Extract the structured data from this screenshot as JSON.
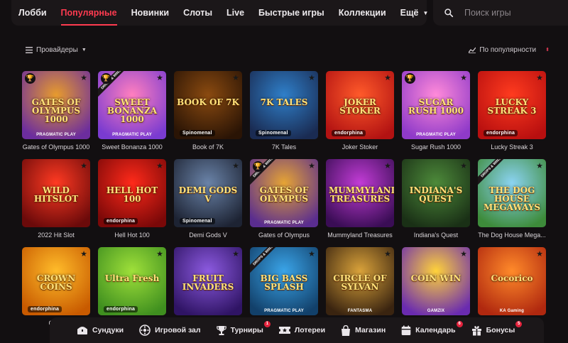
{
  "nav": {
    "items": [
      "Лобби",
      "Популярные",
      "Новинки",
      "Слоты",
      "Live",
      "Быстрые игры",
      "Коллекции"
    ],
    "active_index": 1,
    "more_label": "Ещё"
  },
  "search": {
    "placeholder": "Поиск игры"
  },
  "filters": {
    "providers_label": "Провайдеры",
    "sort_label": "По популярности"
  },
  "games": [
    {
      "label": "Gates of Olympus 1000",
      "art": "GATES OF OLYMPUS 1000",
      "provider": "PRAGMATIC PLAY",
      "trophy": true,
      "drops": false,
      "bg": [
        "#e79b2d",
        "#6c2d9e"
      ]
    },
    {
      "label": "Sweet Bonanza 1000",
      "art": "SWEET BONANZA 1000",
      "provider": "PRAGMATIC PLAY",
      "trophy": true,
      "drops": true,
      "bg": [
        "#ff7fbf",
        "#7a3bd0"
      ]
    },
    {
      "label": "Book of 7K",
      "art": "BOOK OF 7K",
      "provider": "Spinomenal",
      "trophy": false,
      "drops": false,
      "bg": [
        "#8a4a10",
        "#2a1405"
      ]
    },
    {
      "label": "7K Tales",
      "art": "7K TALES",
      "provider": "Spinomenal",
      "trophy": false,
      "drops": false,
      "bg": [
        "#2f7fc9",
        "#1a2b52"
      ]
    },
    {
      "label": "Joker Stoker",
      "art": "JOKER STOKER",
      "provider": "endorphina",
      "trophy": false,
      "drops": false,
      "bg": [
        "#ff5a2a",
        "#b21212"
      ]
    },
    {
      "label": "Sugar Rush 1000",
      "art": "SUGAR RUSH 1000",
      "provider": "PRAGMATIC PLAY",
      "trophy": true,
      "drops": false,
      "bg": [
        "#ff8ad9",
        "#8f3ac9"
      ]
    },
    {
      "label": "Lucky Streak 3",
      "art": "LUCKY STREAK 3",
      "provider": "endorphina",
      "trophy": false,
      "drops": false,
      "bg": [
        "#ff3b1f",
        "#b80f0f"
      ]
    },
    {
      "label": "2022 Hit Slot",
      "art": "WILD HITSLOT",
      "provider": "",
      "trophy": false,
      "drops": false,
      "bg": [
        "#ff3a22",
        "#6b0a0a"
      ]
    },
    {
      "label": "Hell Hot 100",
      "art": "HELL HOT 100",
      "provider": "endorphina",
      "trophy": false,
      "drops": false,
      "bg": [
        "#ff2a1a",
        "#7a0808"
      ]
    },
    {
      "label": "Demi Gods V",
      "art": "DEMI GODS V",
      "provider": "Spinomenal",
      "trophy": false,
      "drops": false,
      "bg": [
        "#6a83a8",
        "#1d2333"
      ]
    },
    {
      "label": "Gates of Olympus",
      "art": "GATES OF OLYMPUS",
      "provider": "PRAGMATIC PLAY",
      "trophy": true,
      "drops": true,
      "bg": [
        "#e6a434",
        "#5a2d8f"
      ]
    },
    {
      "label": "Mummyland Treasures",
      "art": "MUMMYLAND TREASURES",
      "provider": "",
      "trophy": false,
      "drops": false,
      "bg": [
        "#c23cd6",
        "#3a0d55"
      ]
    },
    {
      "label": "Indiana's Quest",
      "art": "INDIANA'S QUEST",
      "provider": "",
      "trophy": false,
      "drops": false,
      "bg": [
        "#4d8a3a",
        "#1a3016"
      ]
    },
    {
      "label": "The Dog House Mega...",
      "art": "THE DOG HOUSE MEGAWAYS",
      "provider": "",
      "trophy": false,
      "drops": true,
      "bg": [
        "#8bd3f2",
        "#3d8b3a"
      ]
    },
    {
      "label": "Crow",
      "art": "CROWN COINS",
      "provider": "endorphina",
      "trophy": false,
      "drops": false,
      "bg": [
        "#ffbc2a",
        "#c85a00"
      ]
    },
    {
      "label": "",
      "art": "Ultra Fresh",
      "provider": "endorphina",
      "trophy": false,
      "drops": false,
      "bg": [
        "#9fe03a",
        "#3f8f1f"
      ]
    },
    {
      "label": "",
      "art": "FRUIT INVADERS",
      "provider": "",
      "trophy": false,
      "drops": false,
      "bg": [
        "#8c5ae0",
        "#2f1464"
      ]
    },
    {
      "label": "",
      "art": "BIG BASS SPLASH",
      "provider": "PRAGMATIC PLAY",
      "trophy": false,
      "drops": true,
      "bg": [
        "#3aa4e8",
        "#12406a"
      ]
    },
    {
      "label": "",
      "art": "CIRCLE OF SYLVAN",
      "provider": "FANTASMA",
      "trophy": false,
      "drops": false,
      "bg": [
        "#d9a23a",
        "#3a2410"
      ]
    },
    {
      "label": "",
      "art": "COIN WIN",
      "provider": "GAMZIX",
      "trophy": false,
      "drops": false,
      "bg": [
        "#ffd23a",
        "#6a2bb0"
      ]
    },
    {
      "label": "",
      "art": "Cocorico",
      "provider": "KA Gaming",
      "trophy": false,
      "drops": false,
      "bg": [
        "#ff8a2a",
        "#b0280f"
      ]
    }
  ],
  "bottom_bar": {
    "items": [
      {
        "label": "Сундуки",
        "icon": "chest-icon",
        "badge": ""
      },
      {
        "label": "Игровой зал",
        "icon": "gamepad-icon",
        "badge": ""
      },
      {
        "label": "Турниры",
        "icon": "trophy-icon",
        "badge": "1"
      },
      {
        "label": "Лотереи",
        "icon": "ticket-icon",
        "badge": ""
      },
      {
        "label": "Магазин",
        "icon": "shopping-bag-icon",
        "badge": ""
      },
      {
        "label": "Календарь",
        "icon": "calendar-icon",
        "badge": "6"
      },
      {
        "label": "Бонусы",
        "icon": "gift-icon",
        "badge": "5"
      }
    ]
  },
  "colors": {
    "accent": "#ff3b50",
    "background": "#120f11",
    "panel": "#1b1719",
    "badge": "#e4223c"
  }
}
